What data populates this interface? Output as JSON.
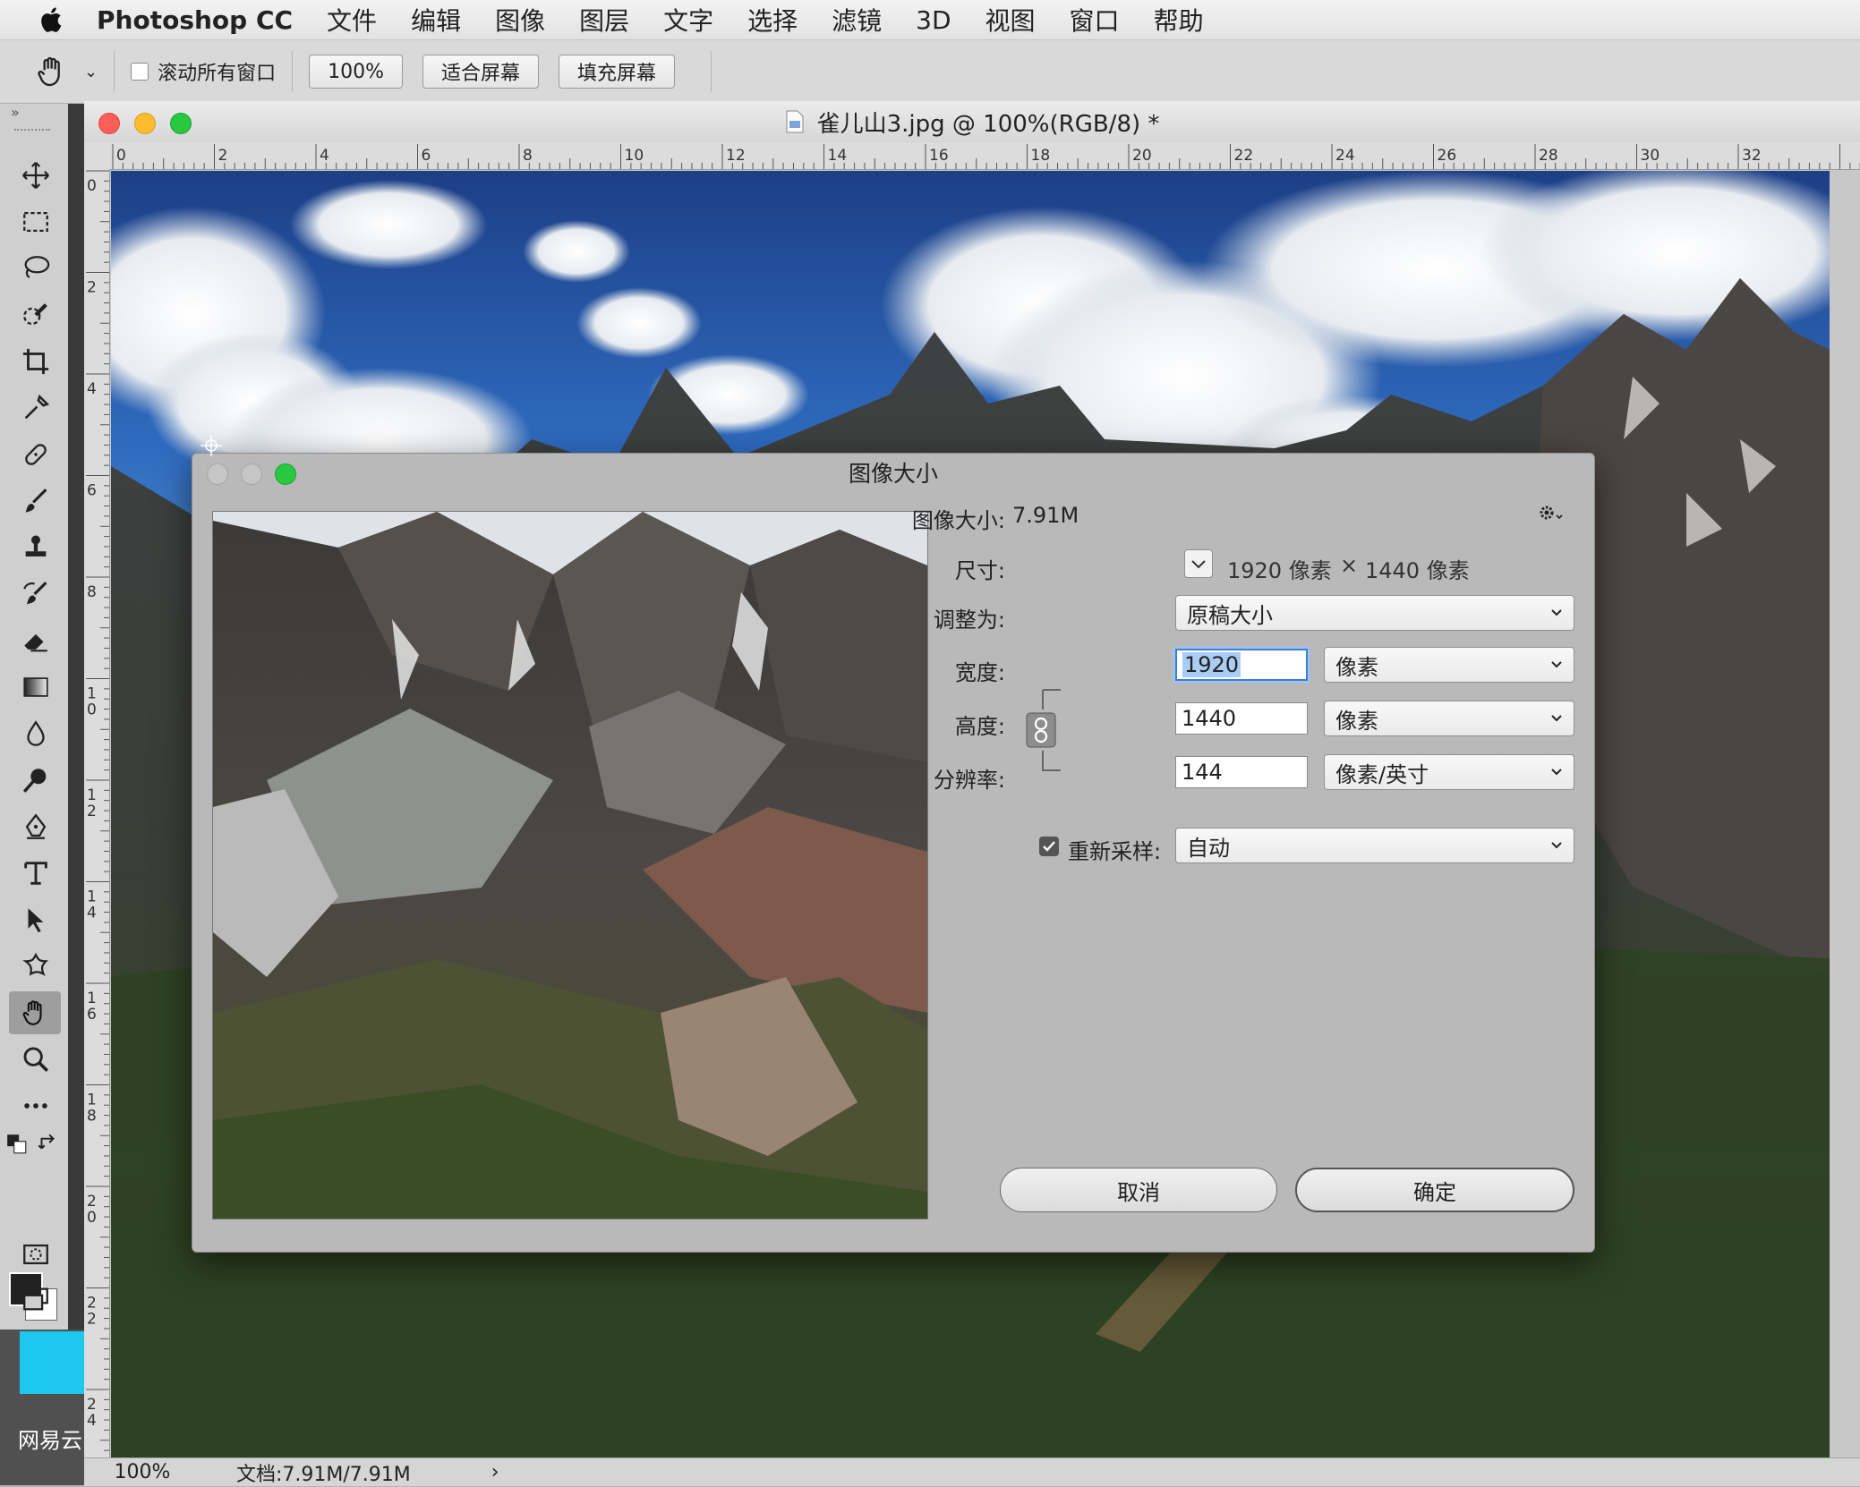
{
  "menubar": {
    "app": "Photoshop CC",
    "items": [
      "文件",
      "编辑",
      "图像",
      "图层",
      "文字",
      "选择",
      "滤镜",
      "3D",
      "视图",
      "窗口",
      "帮助"
    ]
  },
  "options_bar": {
    "scroll_all_label": "滚动所有窗口",
    "zoom_100": "100%",
    "fit_screen": "适合屏幕",
    "fill_screen": "填充屏幕"
  },
  "document": {
    "title": "雀儿山3.jpg @ 100%(RGB/8) *",
    "ruler_h": [
      "0",
      "2",
      "4",
      "6",
      "8",
      "10",
      "12",
      "14",
      "16",
      "18",
      "20",
      "22",
      "24",
      "26",
      "28",
      "30",
      "32"
    ],
    "ruler_v": [
      "0",
      "2",
      "4",
      "6",
      "8",
      "1 0",
      "1 2",
      "1 4",
      "1 6",
      "1 8",
      "2 0",
      "2 2",
      "2 4"
    ],
    "status_zoom": "100%",
    "status_doc": "文档:7.91M/7.91M",
    "status_arrow": "›"
  },
  "left_panel": {
    "label": "网易云"
  },
  "dialog": {
    "title": "图像大小",
    "image_size_label": "图像大小:",
    "image_size_value": "7.91M",
    "dimensions_label": "尺寸:",
    "dim_width": "1920 像素",
    "dim_times": "×",
    "dim_height": "1440 像素",
    "fit_to_label": "调整为:",
    "fit_to_value": "原稿大小",
    "width_label": "宽度:",
    "width_value": "1920",
    "width_unit": "像素",
    "height_label": "高度:",
    "height_value": "1440",
    "height_unit": "像素",
    "resolution_label": "分辨率:",
    "resolution_value": "144",
    "resolution_unit": "像素/英寸",
    "resample_label": "重新采样:",
    "resample_checked": true,
    "resample_value": "自动",
    "cancel": "取消",
    "ok": "确定"
  },
  "colors": {
    "accent": "#3a7fd8",
    "close": "#fc5f57",
    "minimize": "#fdbc2e",
    "zoom": "#28c840"
  }
}
